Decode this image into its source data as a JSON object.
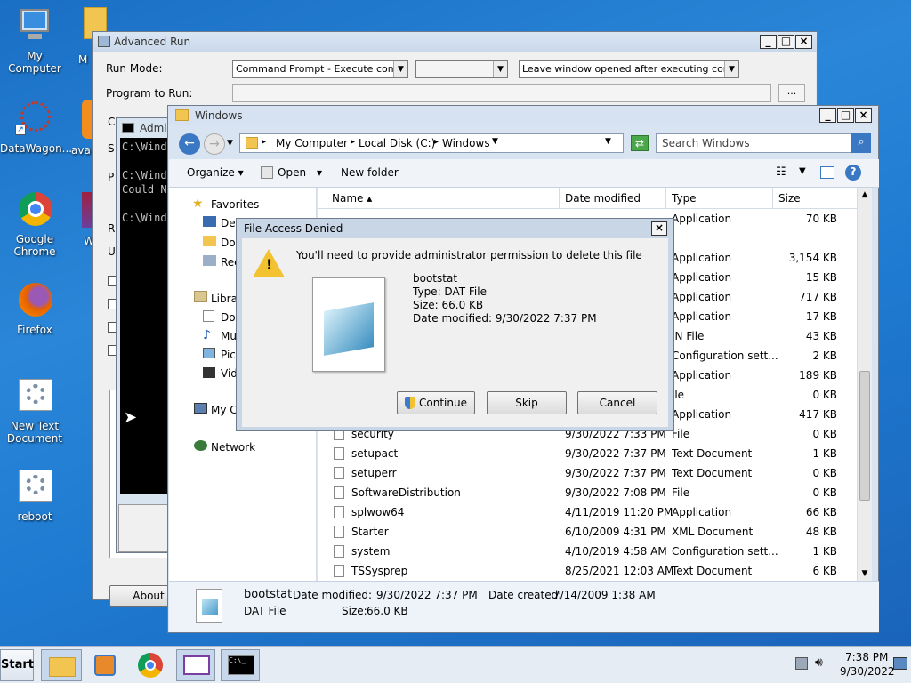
{
  "desktop": {
    "icons": [
      {
        "label": "My Computer"
      },
      {
        "label": "DataWagon..."
      },
      {
        "label": "Google Chrome"
      },
      {
        "label": "Firefox"
      },
      {
        "label": "New Text Document"
      },
      {
        "label": "reboot"
      },
      {
        "label": "M"
      },
      {
        "label": "ava"
      },
      {
        "label": "W"
      }
    ]
  },
  "advanced_run": {
    "title": "Advanced Run",
    "run_mode_label": "Run Mode:",
    "run_mode_value": "Command Prompt - Execute command",
    "window_option_value": "Leave window opened after executing command",
    "program_label": "Program to Run:",
    "about_label": "About",
    "partial_labels": [
      "C",
      "S",
      "P",
      "R",
      "U"
    ]
  },
  "cmd": {
    "title": "Admi",
    "lines": [
      "C:\\Wind",
      "",
      "C:\\Wind",
      "Could N",
      "",
      "C:\\Wind"
    ]
  },
  "explorer": {
    "title": "Windows",
    "breadcrumb": [
      "My Computer",
      "Local Disk (C:)",
      "Windows"
    ],
    "search_placeholder": "Search Windows",
    "toolbar": {
      "organize": "Organize",
      "open": "Open",
      "new_folder": "New folder"
    },
    "columns": {
      "name": "Name",
      "date": "Date modified",
      "type": "Type",
      "size": "Size"
    },
    "nav": {
      "favorites": "Favorites",
      "fav_items": [
        "Des",
        "Dov",
        "Rec"
      ],
      "libraries": "Libra",
      "lib_items": [
        "Doc",
        "Mu",
        "Pict",
        "Vid"
      ],
      "computer": "My C",
      "network": "Network"
    },
    "hidden_rows": [
      {
        "type": "Application",
        "size": "70 KB"
      },
      {
        "type": "",
        "size": ""
      },
      {
        "type": "Application",
        "size": "3,154 KB"
      },
      {
        "type": "Application",
        "size": "15 KB"
      },
      {
        "type": "Application",
        "size": "717 KB"
      },
      {
        "type": "Application",
        "size": "17 KB"
      },
      {
        "type": "IN File",
        "size": "43 KB"
      },
      {
        "type": "Configuration sett...",
        "size": "2 KB"
      },
      {
        "type": "Application",
        "size": "189 KB"
      },
      {
        "type": "ile",
        "size": "0 KB"
      },
      {
        "type": "Application",
        "size": "417 KB"
      }
    ],
    "files": [
      {
        "name": "security",
        "date": "9/30/2022 7:33 PM",
        "type": "File",
        "size": "0 KB"
      },
      {
        "name": "setupact",
        "date": "9/30/2022 7:37 PM",
        "type": "Text Document",
        "size": "1 KB"
      },
      {
        "name": "setuperr",
        "date": "9/30/2022 7:37 PM",
        "type": "Text Document",
        "size": "0 KB"
      },
      {
        "name": "SoftwareDistribution",
        "date": "9/30/2022 7:08 PM",
        "type": "File",
        "size": "0 KB"
      },
      {
        "name": "splwow64",
        "date": "4/11/2019 11:20 PM",
        "type": "Application",
        "size": "66 KB"
      },
      {
        "name": "Starter",
        "date": "6/10/2009 4:31 PM",
        "type": "XML Document",
        "size": "48 KB"
      },
      {
        "name": "system",
        "date": "4/10/2019 4:58 AM",
        "type": "Configuration sett...",
        "size": "1 KB"
      },
      {
        "name": "TSSysprep",
        "date": "8/25/2021 12:03 AM",
        "type": "Text Document",
        "size": "6 KB"
      }
    ],
    "details": {
      "name": "bootstat",
      "type": "DAT File",
      "date_modified_label": "Date modified:",
      "date_modified": "9/30/2022 7:37 PM",
      "date_created_label": "Date created:",
      "date_created": "7/14/2009 1:38 AM",
      "size_label": "Size:",
      "size": "66.0 KB"
    }
  },
  "dialog": {
    "title": "File Access Denied",
    "message": "You'll need to provide administrator permission to delete this file",
    "file_name": "bootstat",
    "file_type": "Type: DAT File",
    "file_size": "Size: 66.0 KB",
    "file_date": "Date modified: 9/30/2022 7:37 PM",
    "continue": "Continue",
    "skip": "Skip",
    "cancel": "Cancel"
  },
  "taskbar": {
    "start": "Start",
    "time": "7:38 PM",
    "date": "9/30/2022"
  }
}
